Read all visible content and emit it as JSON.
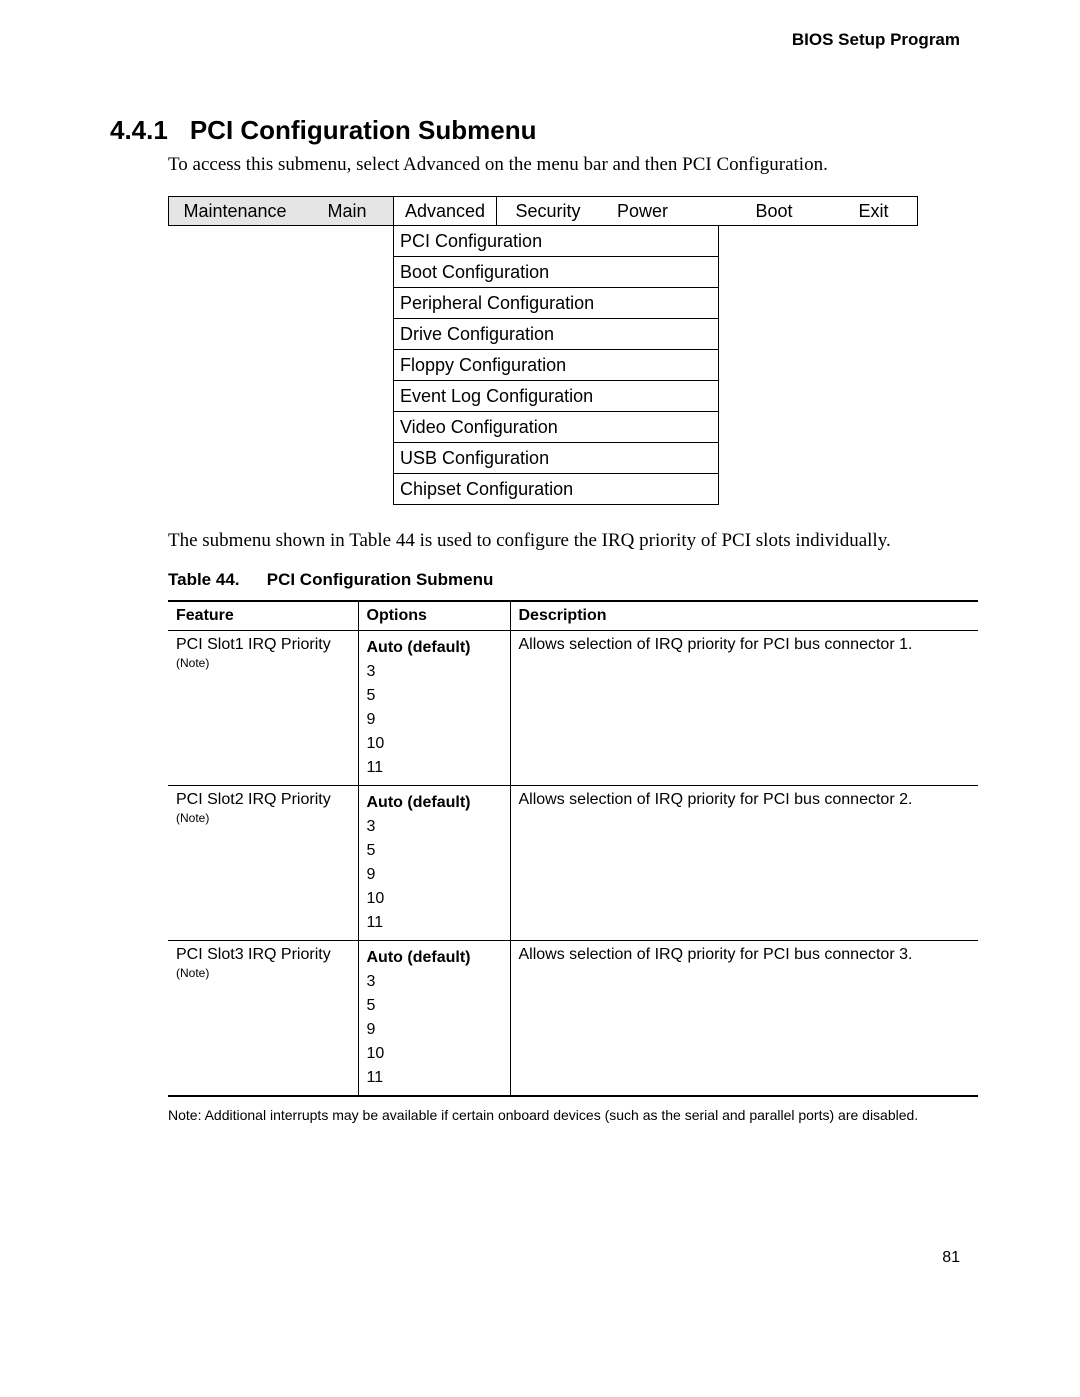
{
  "running_head": "BIOS Setup Program",
  "section_number": "4.4.1",
  "section_title": "PCI Configuration Submenu",
  "intro": "To access this submenu, select Advanced on the menu bar and then PCI Configuration.",
  "menubar": {
    "maintenance": "Maintenance",
    "main": "Main",
    "advanced": "Advanced",
    "security": "Security",
    "power": "Power",
    "boot": "Boot",
    "exit": "Exit"
  },
  "submenu": [
    "PCI Configuration",
    "Boot Configuration",
    "Peripheral Configuration",
    "Drive Configuration",
    "Floppy Configuration",
    "Event Log Configuration",
    "Video Configuration",
    "USB Configuration",
    "Chipset Configuration"
  ],
  "after_menu": "The submenu shown in Table 44 is used to configure the IRQ priority of PCI slots individually.",
  "table_caption_num": "Table 44.",
  "table_caption_title": "PCI Configuration Submenu",
  "table": {
    "headers": {
      "feature": "Feature",
      "options": "Options",
      "description": "Description"
    },
    "note_label": "(Note)",
    "rows": [
      {
        "feature": "PCI Slot1 IRQ Priority",
        "default": "Auto (default)",
        "opts": [
          "3",
          "5",
          "9",
          "10",
          "11"
        ],
        "desc": "Allows selection of IRQ priority for PCI bus connector 1."
      },
      {
        "feature": "PCI Slot2 IRQ Priority",
        "default": "Auto (default)",
        "opts": [
          "3",
          "5",
          "9",
          "10",
          "11"
        ],
        "desc": "Allows selection of IRQ priority for PCI bus connector 2."
      },
      {
        "feature": "PCI Slot3 IRQ Priority",
        "default": "Auto (default)",
        "opts": [
          "3",
          "5",
          "9",
          "10",
          "11"
        ],
        "desc": "Allows selection of IRQ priority for PCI bus connector 3."
      }
    ]
  },
  "footnote": "Note:  Additional interrupts may be available if certain onboard devices (such as the serial and parallel ports) are disabled.",
  "page_number": "81"
}
